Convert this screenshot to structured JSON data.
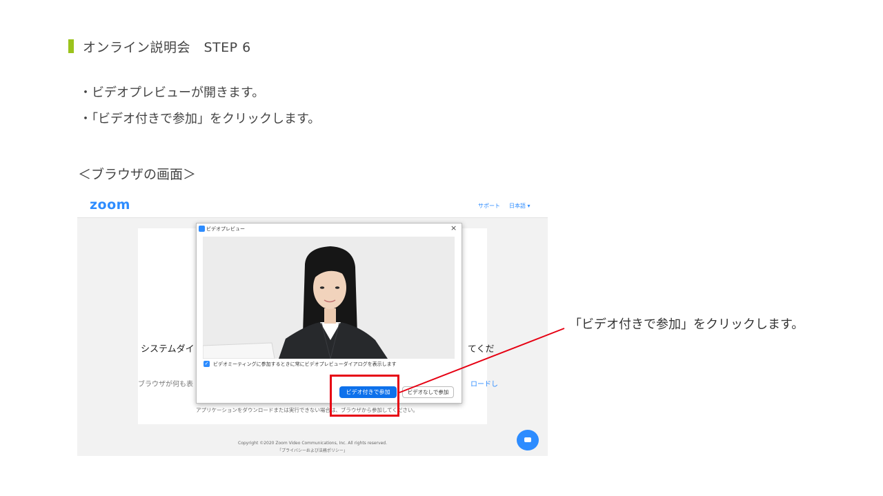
{
  "slide": {
    "title": "オンライン説明会　STEP 6",
    "bullets": [
      "・ビデオプレビューが開きます。",
      "・「ビデオ付きで参加」をクリックします。"
    ],
    "browser_label": "＜ブラウザの画面＞",
    "callout": "「ビデオ付きで参加」をクリックします。",
    "colors": {
      "accent_bar": "#9bc31c",
      "highlight": "#e60012"
    }
  },
  "zoom": {
    "logo": "zoom",
    "support": "サポート",
    "language": "日本語 ▾",
    "background": {
      "system_left": "システムダイ",
      "system_right": "てくだ",
      "browser_left": "ブラウザが何も表",
      "browser_right": "ロードし",
      "app_text": "アプリケーションをダウンロードまたは実行できない場合は、ブラウザから参加してください。"
    },
    "copyright": "Copyright ©2020 Zoom Video Communications, Inc. All rights reserved.",
    "privacy": "「プライバシーおよび法務ポリシー」",
    "colors": {
      "brand": "#2d8cff",
      "button": "#0e71eb"
    }
  },
  "dialog": {
    "title": "ビデオプレビュー",
    "close": "×",
    "checkbox_label": "ビデオミーティングに参加するときに常にビデオプレビューダイアログを表示します",
    "join_with_video": "ビデオ付きで参加",
    "join_without_video": "ビデオなしで参加"
  }
}
